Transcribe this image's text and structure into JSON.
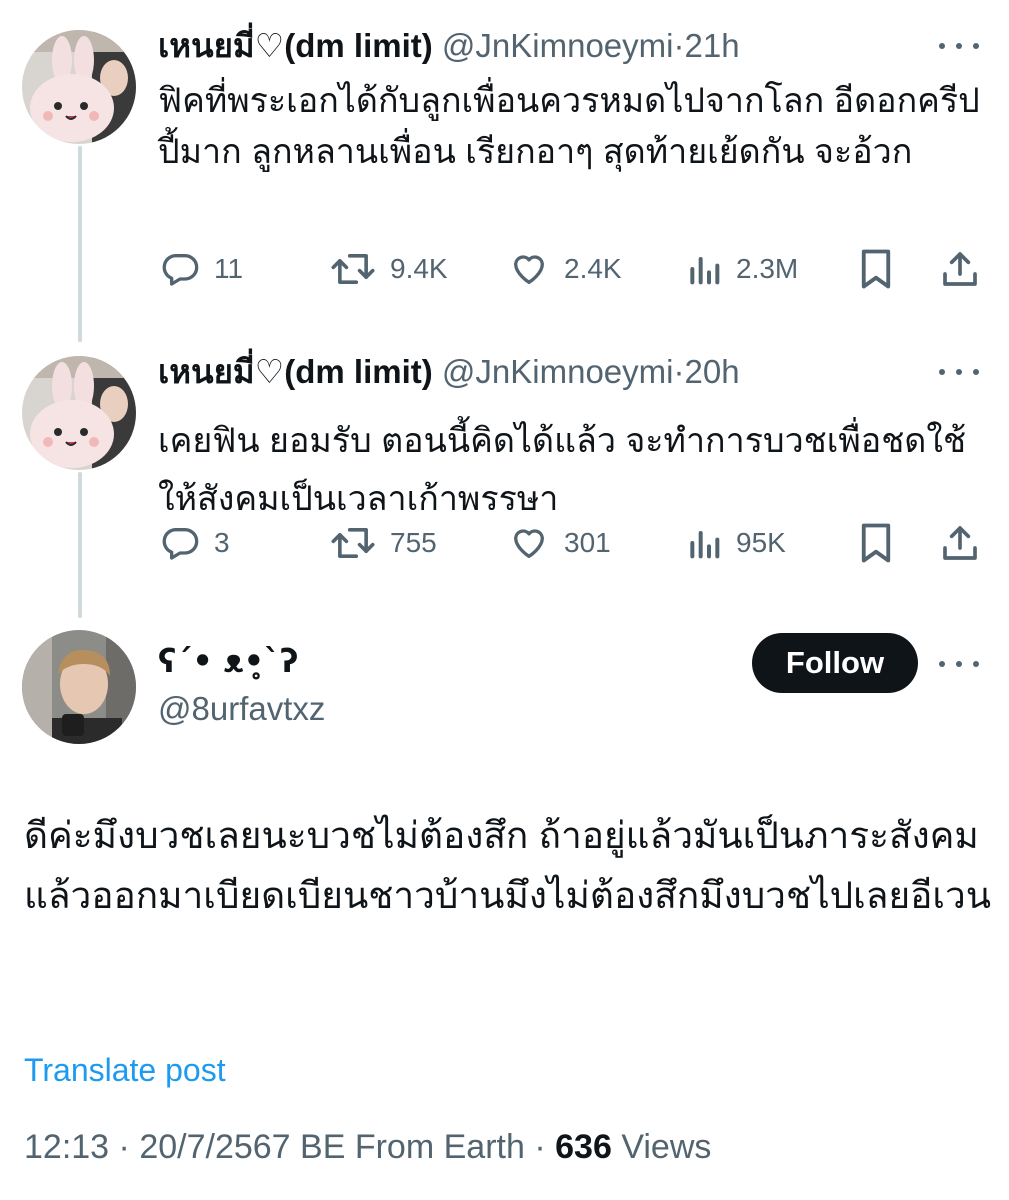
{
  "thread": [
    {
      "name": "เหนยมี่♡(dm limit)",
      "handle": "@JnKimnoeymi",
      "time": "21h",
      "text": "ฟิคที่พระเอกได้กับลูกเพื่อนควรหมดไปจากโลก อีดอกครีปปี้มาก ลูกหลานเพื่อน เรียกอาๆ สุดท้ายเย้ดกัน จะอ้วก",
      "replies": "11",
      "reposts": "9.4K",
      "likes": "2.4K",
      "views": "2.3M"
    },
    {
      "name": "เหนยมี่♡(dm limit)",
      "handle": "@JnKimnoeymi",
      "time": "20h",
      "text": "เคยฟิน ยอมรับ ตอนนี้คิดได้แล้ว จะทำการบวชเพื่อชดใช้ให้สังคมเป็นเวลาเก้าพรรษา",
      "replies": "3",
      "reposts": "755",
      "likes": "301",
      "views": "95K"
    }
  ],
  "separator": "·",
  "main_post": {
    "name": "ʕ´• ᴥ•̥`ʔ",
    "handle": "@8urfavtxz",
    "follow_label": "Follow",
    "text": "ดีค่ะมึงบวชเลยนะบวชไม่ต้องสึก ถ้าอยู่แล้วมันเป็นภาระสังคมแล้วออกมาเบียดเบียนชาวบ้านมึงไม่ต้องสึกมึงบวชไปเลยอีเวน",
    "translate_label": "Translate post",
    "time": "12:13",
    "date": "20/7/2567 BE",
    "source": "From Earth",
    "views_count": "636",
    "views_label": "Views"
  },
  "icons": [
    "reply-icon",
    "repost-icon",
    "like-icon",
    "views-icon",
    "bookmark-icon",
    "share-icon",
    "more-icon"
  ],
  "colors": {
    "text": "#0f1419",
    "secondary": "#536471",
    "link": "#1d9bf0",
    "button": "#0f1419",
    "thread_line": "#cfd9de"
  }
}
